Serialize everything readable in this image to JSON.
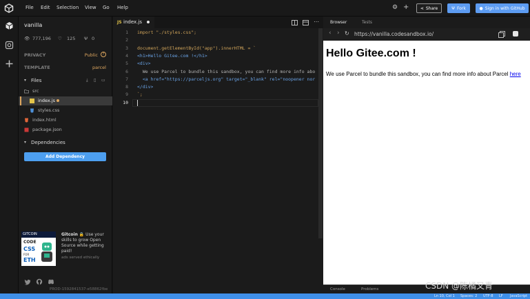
{
  "menu": [
    "File",
    "Edit",
    "Selection",
    "View",
    "Go",
    "Help"
  ],
  "topbar": {
    "share_label": "Share",
    "fork_label": "Fork",
    "signin_label": "Sign in with GitHub"
  },
  "sidebar": {
    "project_name": "vanilla",
    "views": "777,196",
    "likes": "125",
    "forks": "0",
    "privacy_label": "PRIVACY",
    "privacy_value": "Public",
    "template_label": "TEMPLATE",
    "template_value": "parcel",
    "files_label": "Files",
    "tree": [
      {
        "name": "src",
        "type": "folder"
      },
      {
        "name": "index.js",
        "type": "js",
        "modified": true
      },
      {
        "name": "styles.css",
        "type": "css"
      },
      {
        "name": "index.html",
        "type": "html"
      },
      {
        "name": "package.json",
        "type": "json"
      }
    ],
    "dependencies_label": "Dependencies",
    "add_dependency_label": "Add Dependency",
    "ad": {
      "brand": "GITCOIN",
      "title": "Gitcoin",
      "text": "Use your skills to grow Open Source while getting paid!",
      "img_words": [
        "CODE",
        "CSS",
        "FOR",
        "ETH"
      ],
      "footer": "ads served ethically"
    },
    "prod_id": "PROD-1592841537-e58862fbe"
  },
  "editor": {
    "tab_label": "index.js",
    "lines": [
      {
        "n": "1",
        "text": "import \"./styles.css\";"
      },
      {
        "n": "2",
        "text": ""
      },
      {
        "n": "3",
        "text": "document.getElementById(\"app\").innerHTML = `"
      },
      {
        "n": "4",
        "text": "<h1>Hello Gitee.com !</h1>"
      },
      {
        "n": "5",
        "text": "<div>"
      },
      {
        "n": "6",
        "text": "  We use Parcel to bundle this sandbox, you can find more info abo"
      },
      {
        "n": "7",
        "text": "  <a href=\"https://parceljs.org\" target=\"_blank\" rel=\"noopener nor"
      },
      {
        "n": "8",
        "text": "</div>"
      },
      {
        "n": "9",
        "text": "`;"
      },
      {
        "n": "10",
        "text": ""
      }
    ]
  },
  "preview": {
    "tab_browser": "Browser",
    "tab_tests": "Tests",
    "url": "https://vanilla.codesandbox.io/",
    "heading": "Hello Gitee.com !",
    "paragraph": "We use Parcel to bundle this sandbox, you can find more info about Parcel ",
    "link_text": "here",
    "bottom_console": "Console",
    "bottom_problems": "Problems"
  },
  "status": {
    "position": "Ln 10, Col 1",
    "spaces": "Spaces: 2",
    "encoding": "UTF-8",
    "eol": "LF",
    "language": "JavaScript"
  },
  "watermark": "CSDN @陈橘又青",
  "colors": {
    "accent": "#5d9cf2",
    "status": "#3f8fe8",
    "template": "#e0a860",
    "modified": "#e0a860"
  }
}
